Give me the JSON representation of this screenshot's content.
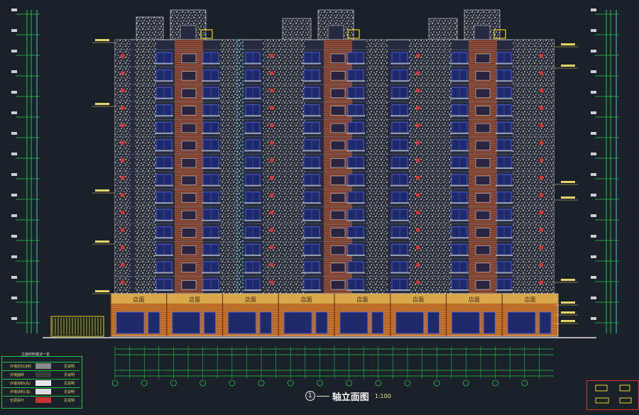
{
  "drawing_title": "轴立面图",
  "title_prefix": "①—",
  "scale_text": "1:100",
  "storefront_sign": "店面",
  "storefront_count": 8,
  "legend": {
    "title": "立面材料做法一览",
    "rows": [
      {
        "label": "外墙仿石涂料",
        "color": "#8a8a8a",
        "note": "见说明"
      },
      {
        "label": "外墙面砖",
        "color": "#3a3a3a",
        "note": "见说明"
      },
      {
        "label": "外墙涂料(白)",
        "color": "#e8e8e8",
        "note": "见说明"
      },
      {
        "label": "外墙涂料(浅)",
        "color": "#dcdcdc",
        "note": "见说明"
      },
      {
        "label": "空调百叶",
        "color": "#c83232",
        "note": "见说明"
      }
    ]
  },
  "colors": {
    "background": "#1b2129",
    "building_body": "#262b40",
    "brick_panel": "#8b4c3a",
    "stone_texture": "#dcdcdc",
    "window_frame": "#4a5bd8",
    "balcony_rail": "#9aa2b8",
    "storefront": "#c8752c",
    "storefront_sign": "#d9a84a",
    "dimension_line": "#21c24a",
    "annotation": "#e6d46a",
    "accent_red": "#e03131",
    "rail_yellow": "#e8d21e",
    "stair_cyan": "#3cc8e0"
  },
  "floors": 14
}
